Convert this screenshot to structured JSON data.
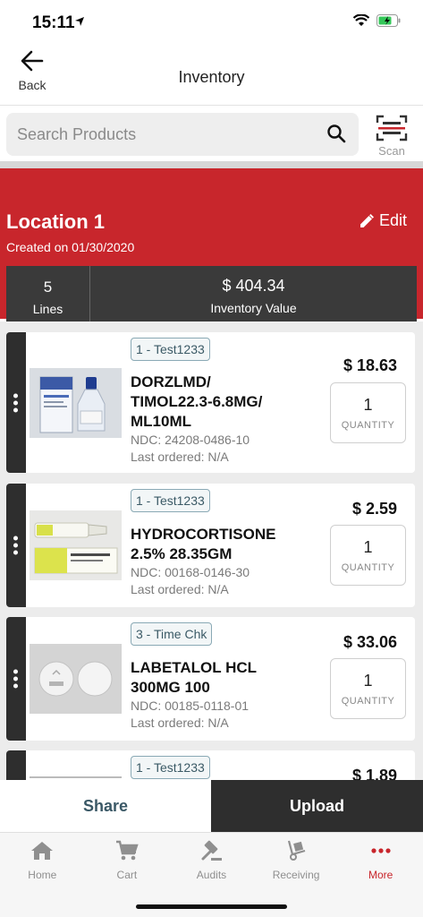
{
  "status": {
    "time": "15:11"
  },
  "nav": {
    "back_label": "Back",
    "title": "Inventory"
  },
  "search": {
    "placeholder": "Search Products",
    "scan_label": "Scan"
  },
  "location": {
    "name": "Location 1",
    "created": "Created on 01/30/2020",
    "edit_label": "Edit",
    "lines_count": "5",
    "lines_label": "Lines",
    "inventory_value": "$ 404.34",
    "inventory_value_label": "Inventory Value"
  },
  "products": [
    {
      "tag": "1 - Test1233",
      "name_line1": "DORZLMD/",
      "name_line2": "TIMOL22.3-6.8MG/",
      "name_line3": "ML10ML",
      "ndc": "NDC: 24208-0486-10",
      "last_ordered": "Last ordered: N/A",
      "price": "$ 18.63",
      "quantity": "1",
      "quantity_label": "QUANTITY"
    },
    {
      "tag": "1 - Test1233",
      "name_line1": "HYDROCORTISONE",
      "name_line2": "2.5%  28.35GM",
      "ndc": "NDC: 00168-0146-30",
      "last_ordered": "Last ordered: N/A",
      "price": "$ 2.59",
      "quantity": "1",
      "quantity_label": "QUANTITY"
    },
    {
      "tag": "3 - Time Chk",
      "name_line1": "LABETALOL HCL",
      "name_line2": "300MG 100",
      "ndc": "NDC: 00185-0118-01",
      "last_ordered": "Last ordered: N/A",
      "price": "$ 33.06",
      "quantity": "1",
      "quantity_label": "QUANTITY"
    },
    {
      "tag": "1 - Test1233",
      "price": "$ 1.89"
    }
  ],
  "actions": {
    "share": "Share",
    "upload": "Upload"
  },
  "tabs": [
    {
      "label": "Home",
      "icon": "home-icon"
    },
    {
      "label": "Cart",
      "icon": "cart-icon"
    },
    {
      "label": "Audits",
      "icon": "gavel-icon"
    },
    {
      "label": "Receiving",
      "icon": "hand-truck-icon"
    },
    {
      "label": "More",
      "icon": "more-icon",
      "active": true
    }
  ],
  "colors": {
    "brand_red": "#c8262c",
    "dark": "#2e2e2e",
    "tag_text": "#3b5a66"
  }
}
